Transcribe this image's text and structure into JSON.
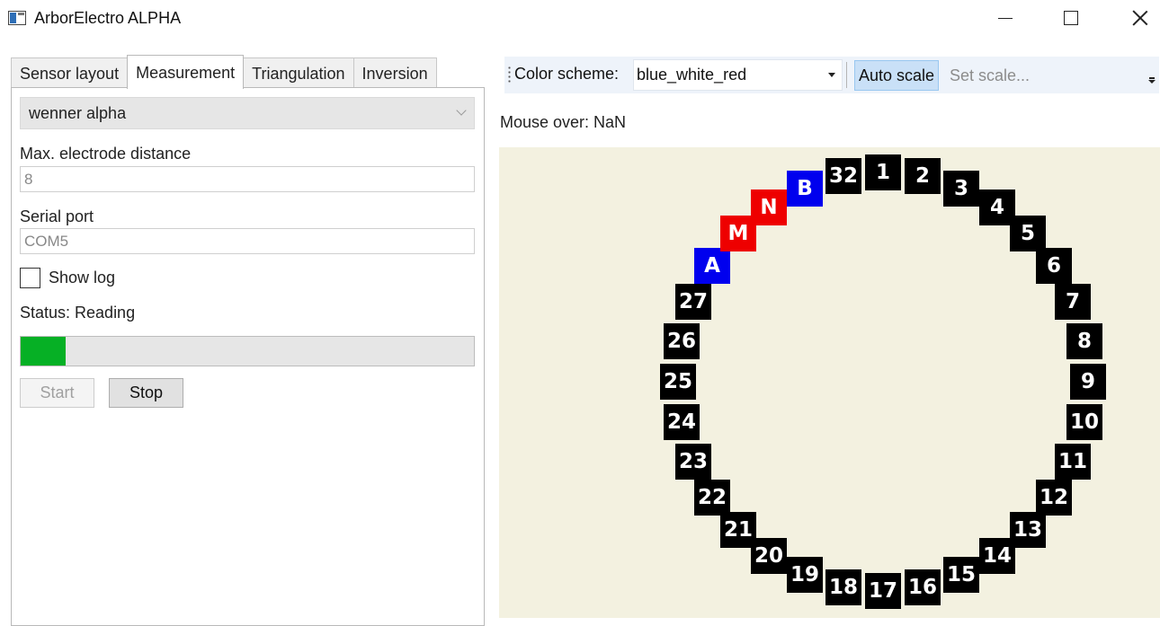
{
  "window": {
    "title": "ArborElectro ALPHA"
  },
  "tabs": [
    {
      "label": "Sensor layout",
      "active": false
    },
    {
      "label": "Measurement",
      "active": true
    },
    {
      "label": "Triangulation",
      "active": false
    },
    {
      "label": "Inversion",
      "active": false
    }
  ],
  "measurement": {
    "method_selected": "wenner alpha",
    "max_distance_label": "Max. electrode distance",
    "max_distance_value": "8",
    "serial_port_label": "Serial port",
    "serial_port_value": "COM5",
    "show_log_label": "Show log",
    "show_log_checked": false,
    "status_text": "Status: Reading",
    "progress_fraction": 0.1,
    "start_label": "Start",
    "stop_label": "Stop"
  },
  "toolbar": {
    "color_scheme_label": "Color scheme:",
    "color_scheme_value": "blue_white_red",
    "auto_scale_label": "Auto scale",
    "set_scale_placeholder": "Set scale..."
  },
  "mouse_over_text": "Mouse over: NaN",
  "colors": {
    "canvas_background": "#f3f1e0",
    "electrode_default": "#000000",
    "current_electrode": "#0000ee",
    "potential_electrode": "#ee0000",
    "progress_fill": "#06b025",
    "toolbar_background": "#eef3fa"
  },
  "electrodes": [
    {
      "label": "1",
      "role": "normal"
    },
    {
      "label": "2",
      "role": "normal"
    },
    {
      "label": "3",
      "role": "normal"
    },
    {
      "label": "4",
      "role": "normal"
    },
    {
      "label": "5",
      "role": "normal"
    },
    {
      "label": "6",
      "role": "normal"
    },
    {
      "label": "7",
      "role": "normal"
    },
    {
      "label": "8",
      "role": "normal"
    },
    {
      "label": "9",
      "role": "normal"
    },
    {
      "label": "10",
      "role": "normal"
    },
    {
      "label": "11",
      "role": "normal"
    },
    {
      "label": "12",
      "role": "normal"
    },
    {
      "label": "13",
      "role": "normal"
    },
    {
      "label": "14",
      "role": "normal"
    },
    {
      "label": "15",
      "role": "normal"
    },
    {
      "label": "16",
      "role": "normal"
    },
    {
      "label": "17",
      "role": "normal"
    },
    {
      "label": "18",
      "role": "normal"
    },
    {
      "label": "19",
      "role": "normal"
    },
    {
      "label": "20",
      "role": "normal"
    },
    {
      "label": "21",
      "role": "normal"
    },
    {
      "label": "22",
      "role": "normal"
    },
    {
      "label": "23",
      "role": "normal"
    },
    {
      "label": "24",
      "role": "normal"
    },
    {
      "label": "25",
      "role": "normal"
    },
    {
      "label": "26",
      "role": "normal"
    },
    {
      "label": "27",
      "role": "normal"
    },
    {
      "label": "A",
      "role": "current"
    },
    {
      "label": "M",
      "role": "potential"
    },
    {
      "label": "N",
      "role": "potential"
    },
    {
      "label": "B",
      "role": "current"
    },
    {
      "label": "32",
      "role": "normal"
    }
  ]
}
